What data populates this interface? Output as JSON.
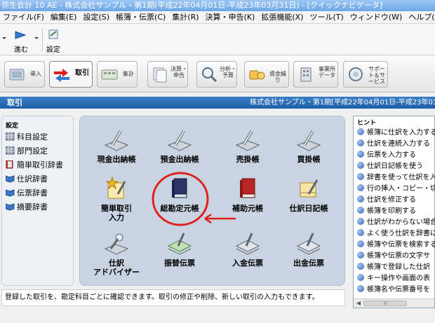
{
  "window": {
    "title": "弥生会計 10 AE - 株式会社サンプル・第1期(平成22年04月01日-平成23年03月31日) - [クイックナビゲータ]"
  },
  "menu": [
    {
      "label": "ファイル(F)"
    },
    {
      "label": "編集(E)"
    },
    {
      "label": "設定(S)"
    },
    {
      "label": "帳簿・伝票(C)"
    },
    {
      "label": "集計(R)"
    },
    {
      "label": "決算・申告(K)"
    },
    {
      "label": "拡張機能(X)"
    },
    {
      "label": "ツール(T)"
    },
    {
      "label": "ウィンドウ(W)"
    },
    {
      "label": "ヘルプ(H)"
    }
  ],
  "toolbar": {
    "forward_label": "進む",
    "settings_label": "設定"
  },
  "modules": [
    {
      "label": "導入"
    },
    {
      "label": "取引"
    },
    {
      "label": "集計"
    },
    {
      "label": "決算・申告"
    },
    {
      "label": "分析・予算"
    },
    {
      "label": "資金繰り"
    },
    {
      "label": "事業所データ"
    },
    {
      "label": "サポート＆サービス"
    }
  ],
  "section": {
    "title": "取引",
    "info": "株式会社サンプル・第1期[平成22年04月01日-平成23年03月"
  },
  "left_panel": {
    "heading": "設定",
    "items": [
      {
        "label": "科目設定"
      },
      {
        "label": "部門設定"
      },
      {
        "label": "簡単取引辞書"
      },
      {
        "label": "仕訳辞書"
      },
      {
        "label": "伝票辞書"
      },
      {
        "label": "摘要辞書"
      }
    ]
  },
  "center_panel": {
    "items": [
      {
        "label": "現金出納帳"
      },
      {
        "label": "預金出納帳"
      },
      {
        "label": "売掛帳"
      },
      {
        "label": "買掛帳"
      },
      {
        "label": "簡単取引\n入力"
      },
      {
        "label": "総勘定元帳"
      },
      {
        "label": "補助元帳"
      },
      {
        "label": "仕訳日記帳"
      },
      {
        "label": "仕訳\nアドバイザー"
      },
      {
        "label": "振替伝票"
      },
      {
        "label": "入金伝票"
      },
      {
        "label": "出金伝票"
      }
    ]
  },
  "hint_panel": {
    "heading": "ヒント",
    "items": [
      {
        "label": "帳簿に仕訳を入力する"
      },
      {
        "label": "仕訳を連続入力する"
      },
      {
        "label": "伝票を入力する"
      },
      {
        "label": "仕訳日記帳を使う"
      },
      {
        "label": "辞書を使って仕訳を入"
      },
      {
        "label": "行の挿入・コピー・切り"
      },
      {
        "label": "仕訳を修正する"
      },
      {
        "label": "帳簿を印刷する"
      },
      {
        "label": "仕訳がわからない場合"
      },
      {
        "label": "よく使う仕訳を辞書に"
      },
      {
        "label": "帳簿や伝票を検索する"
      },
      {
        "label": "帳簿や伝票の文字サ"
      },
      {
        "label": "帳簿で登録した仕訳"
      },
      {
        "label": "キー操作や画面の表"
      },
      {
        "label": "帳簿名や伝票番号を"
      }
    ],
    "scroll_thumb": "III"
  },
  "description": "登録した取引を、勘定科目ごとに確認できます。取引の修正や削除、新しい取引の入力もできます。",
  "colors": {
    "section_bar": "#1e5fa8",
    "annotation_red": "#e0201b",
    "center_bg": "#c9d4e3"
  }
}
